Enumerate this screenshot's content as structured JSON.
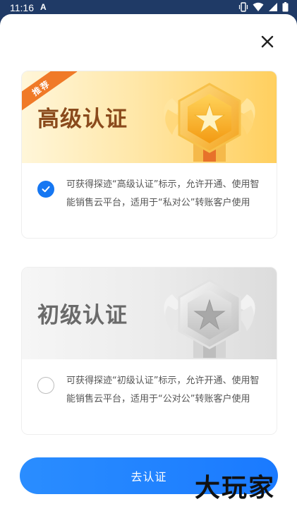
{
  "status": {
    "time": "11:16",
    "notification_letter": "A"
  },
  "dialog": {
    "close_icon": "close-icon"
  },
  "cards": {
    "senior": {
      "badge": "推荐",
      "title": "高级认证",
      "description": "可获得探迹“高级认证”标示，允许开通、使用智能销售云平台，适用于“私对公”转账客户使用",
      "selected": true
    },
    "junior": {
      "title": "初级认证",
      "description": "可获得探迹“初级认证”标示，允许开通、使用智能销售云平台，适用于“公对公”转账客户使用",
      "selected": false
    }
  },
  "cta": {
    "label": "去认证"
  },
  "watermark": {
    "text": "大玩家"
  },
  "colors": {
    "primary": "#1677f2",
    "senior_title": "#8a4a1c",
    "ribbon": "#f07a28"
  }
}
